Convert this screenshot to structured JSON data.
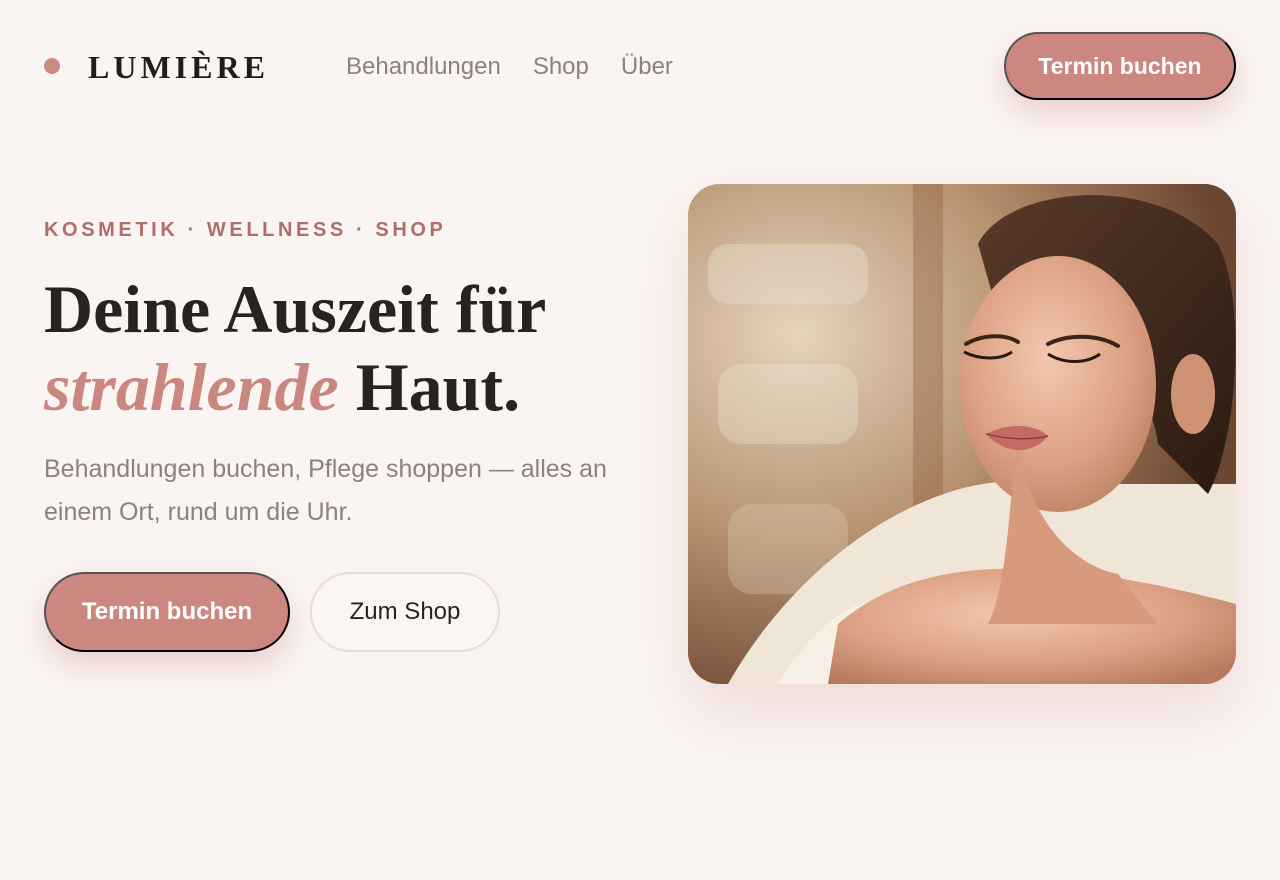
{
  "brand": {
    "name": "LUMIÈRE",
    "accent_color": "#cc8a82"
  },
  "nav": {
    "items": [
      {
        "label": "Behandlungen"
      },
      {
        "label": "Shop"
      },
      {
        "label": "Über"
      }
    ]
  },
  "header": {
    "cta_label": "Termin buchen"
  },
  "hero": {
    "eyebrow": "KOSMETIK · WELLNESS · SHOP",
    "headline_line1": "Deine Auszeit für",
    "headline_accent": "strahlende",
    "headline_line2_rest": " Haut.",
    "lead": "Behandlungen buchen, Pflege shoppen — alles an einem Ort, rund um die Uhr.",
    "primary_cta": "Termin buchen",
    "secondary_cta": "Zum Shop",
    "image_icon": "woman-relaxing-photo"
  },
  "colors": {
    "background": "#faf4f2",
    "primary": "#cc8780",
    "text": "#2a2221",
    "muted": "#8e817d",
    "eyebrow": "#b06e68"
  }
}
